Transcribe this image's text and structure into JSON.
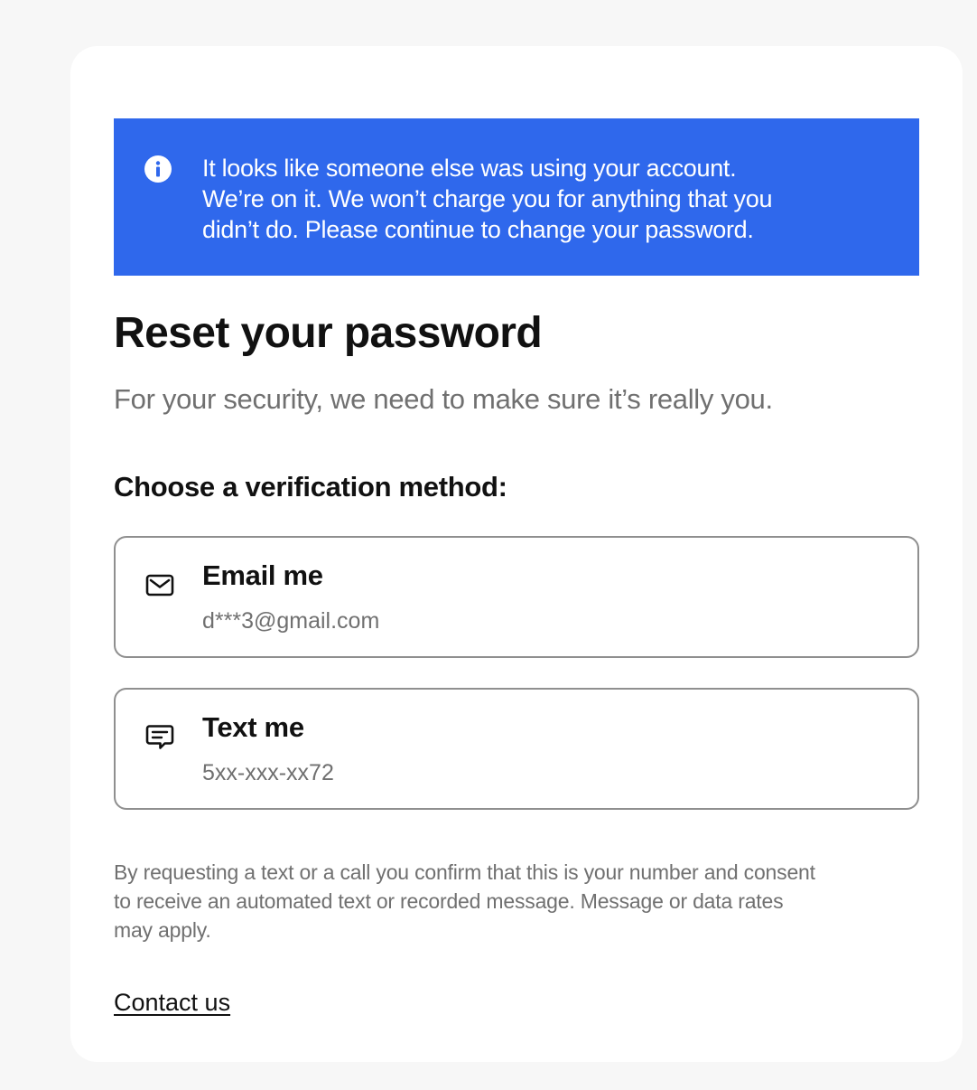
{
  "banner": {
    "icon": "info-icon",
    "background_color": "#2f68ec",
    "lines": [
      "It looks like someone else was using your account.",
      "We’re on it. We won’t charge you for anything that you",
      "didn’t do. Please continue to change your password."
    ]
  },
  "page": {
    "title": "Reset your password",
    "subtitle": "For your security, we need to make sure it’s really you.",
    "section_label": "Choose a verification method:"
  },
  "options": [
    {
      "icon": "envelope-icon",
      "label": "Email me",
      "detail": "d***3@gmail.com"
    },
    {
      "icon": "chat-message-icon",
      "label": "Text me",
      "detail": "5xx-xxx-xx72"
    }
  ],
  "disclaimer": {
    "lines": [
      "By requesting a text or a call you confirm that this is your number and consent",
      "to receive an automated text or recorded message. Message or data rates",
      "may apply."
    ]
  },
  "footer": {
    "contact_link": "Contact us"
  }
}
